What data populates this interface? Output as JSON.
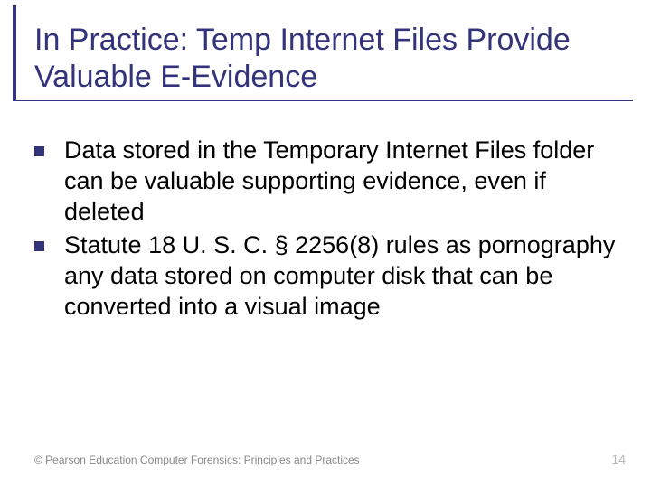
{
  "title": "In Practice: Temp Internet Files Provide Valuable E-Evidence",
  "bullets": [
    "Data stored in the Temporary Internet Files folder can be valuable supporting evidence, even if deleted",
    "Statute 18 U. S. C. § 2256(8) rules as pornography any data stored on computer disk that can be converted into a visual image"
  ],
  "footer": {
    "copyright": "© Pearson Education  Computer Forensics: Principles and Practices",
    "page_number": "14"
  },
  "colors": {
    "accent": "#33337c"
  }
}
